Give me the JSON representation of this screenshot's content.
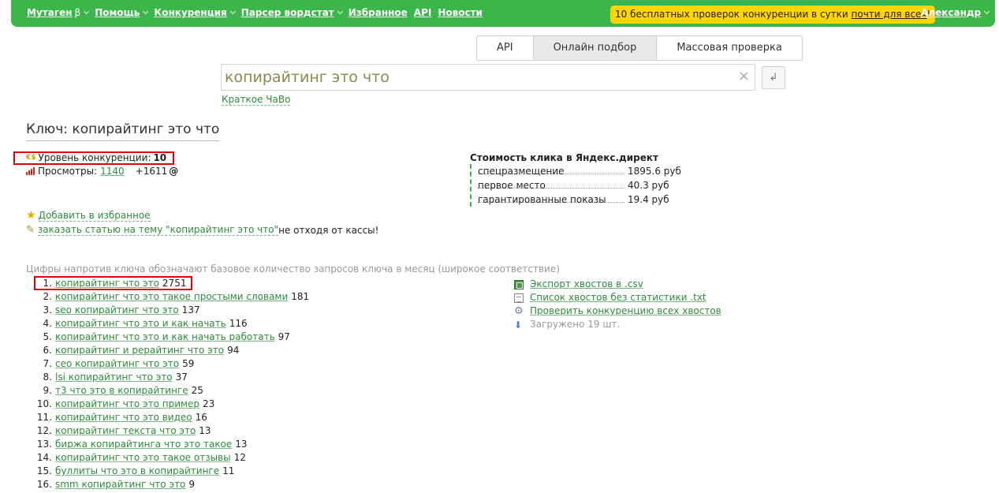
{
  "nav": {
    "brand": "Мутаген",
    "beta": "β",
    "items": [
      "Помощь",
      "Конкуренция",
      "Парсер вордстат",
      "Избранное",
      "API",
      "Новости"
    ]
  },
  "promo": {
    "text": "10 бесплатных проверок конкуренции в сутки ",
    "link": "почти для всех",
    "suffix": "!"
  },
  "user": "Александр",
  "tabs": [
    "API",
    "Онлайн подбор",
    "Массовая проверка"
  ],
  "search": {
    "value": "копирайтинг это что",
    "clear": "×",
    "enter": "↲"
  },
  "faq": "Краткое ЧаВо",
  "key": {
    "title": "Ключ: копирайтинг это что"
  },
  "competition": {
    "label": "Уровень конкуренции: ",
    "value": "10",
    "icon_text": "€$"
  },
  "views": {
    "label": "Просмотры: ",
    "value": "1140",
    "extra": "+1611"
  },
  "price": {
    "title": "Стоимость клика в Яндекс.директ",
    "rows": [
      {
        "label": "спецразмещение",
        "value": "1895.6 руб"
      },
      {
        "label": "первое место",
        "value": "40.3 руб"
      },
      {
        "label": "гарантированные показы",
        "value": "19.4 руб"
      }
    ]
  },
  "actions": {
    "favorite": "Добавить в избранное",
    "order_link": "заказать статью на тему \"копирайтинг это что\"",
    "order_suffix": " не отходя от кассы!"
  },
  "note": "Цифры напротив ключа обозначают базовое количество запросов ключа в месяц (широкое соответствие)",
  "tails": [
    {
      "num": "1.",
      "text": "копирайтинг что это",
      "count": "2751"
    },
    {
      "num": "2.",
      "text": "копирайтинг что это такое простыми словами",
      "count": "181"
    },
    {
      "num": "3.",
      "text": "seo копирайтинг что это",
      "count": "137"
    },
    {
      "num": "4.",
      "text": "копирайтинг что это и как начать",
      "count": "116"
    },
    {
      "num": "5.",
      "text": "копирайтинг что это и как начать работать",
      "count": "97"
    },
    {
      "num": "6.",
      "text": "копирайтинг и рерайтинг что это",
      "count": "94"
    },
    {
      "num": "7.",
      "text": "сео копирайтинг что это",
      "count": "59"
    },
    {
      "num": "8.",
      "text": "lsi копирайтинг что это",
      "count": "37"
    },
    {
      "num": "9.",
      "text": "т3 что это в копирайтинге",
      "count": "25"
    },
    {
      "num": "10.",
      "text": "копирайтинг что это пример",
      "count": "23"
    },
    {
      "num": "11.",
      "text": "копирайтинг что это видео",
      "count": "16"
    },
    {
      "num": "12.",
      "text": "копирайтинг текста что это",
      "count": "13"
    },
    {
      "num": "13.",
      "text": "биржа копирайтинга что это такое",
      "count": "13"
    },
    {
      "num": "14.",
      "text": "копирайтинг что это такое отзывы",
      "count": "12"
    },
    {
      "num": "15.",
      "text": "буллиты что это в копирайтинге",
      "count": "11"
    },
    {
      "num": "16.",
      "text": "smm копирайтинг что это",
      "count": "9"
    }
  ],
  "right_links": {
    "export_csv": "Экспорт хвостов в .csv",
    "list_txt": "Список хвостов без статистики .txt",
    "check_all": "Проверить конкуренцию всех хвостов",
    "loaded": "Загружено 19 шт."
  },
  "colors": {
    "topbar": "#3cb54a",
    "promo": "#ffd400",
    "link": "#2f8c3a",
    "highlight": "#e00000"
  }
}
